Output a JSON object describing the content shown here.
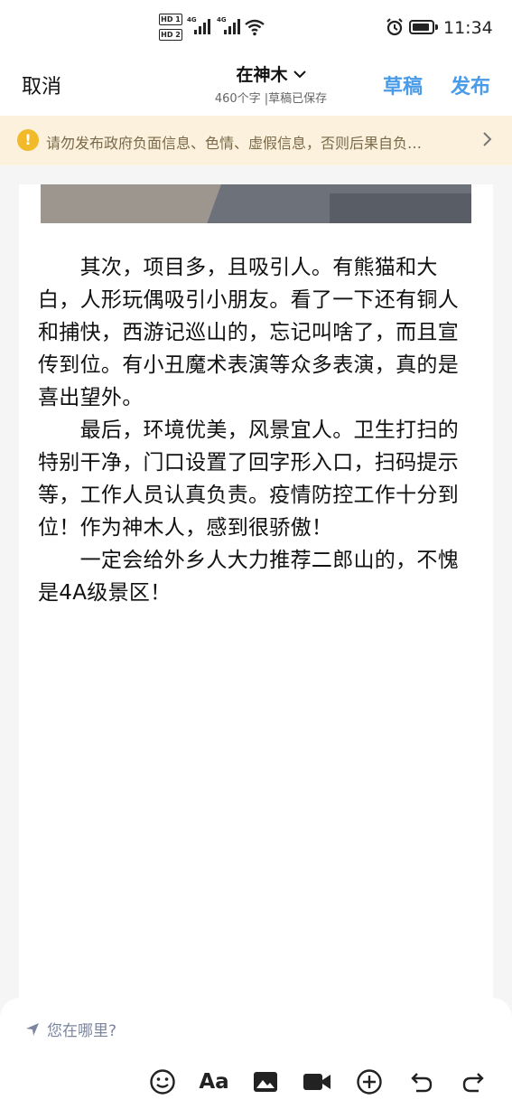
{
  "status_bar": {
    "hd1": "HD 1",
    "hd2": "HD 2",
    "network1": "4G",
    "network2": "4G",
    "battery_icon": "battery-icon",
    "alarm_icon": "alarm-icon",
    "wifi_icon": "wifi-icon",
    "time": "11:34"
  },
  "nav": {
    "cancel_label": "取消",
    "title": "在神木",
    "subtitle": "460个字 |草稿已保存",
    "draft_label": "草稿",
    "publish_label": "发布",
    "accent_color": "#4a9be8"
  },
  "warning": {
    "text": "请勿发布政府负面信息、色情、虚假信息，否则后果自负…",
    "icon": "exclamation-icon",
    "color": "#fbf1dc"
  },
  "article": {
    "paragraphs": [
      "　　其次，项目多，且吸引人。有熊猫和大白，人形玩偶吸引小朋友。看了一下还有铜人和捕快，西游记巡山的，忘记叫啥了，而且宣传到位。有小丑魔术表演等众多表演，真的是喜出望外。",
      "　　最后，环境优美，风景宜人。卫生打扫的特别干净，门口设置了回字形入口，扫码提示等，工作人员认真负责。疫情防控工作十分到位！作为神木人，感到很骄傲！",
      "　　一定会给外乡人大力推荐二郎山的，不愧是4A级景区！"
    ]
  },
  "bottom": {
    "location_placeholder": "您在哪里?",
    "tools": {
      "aa_label": "Aa"
    }
  }
}
